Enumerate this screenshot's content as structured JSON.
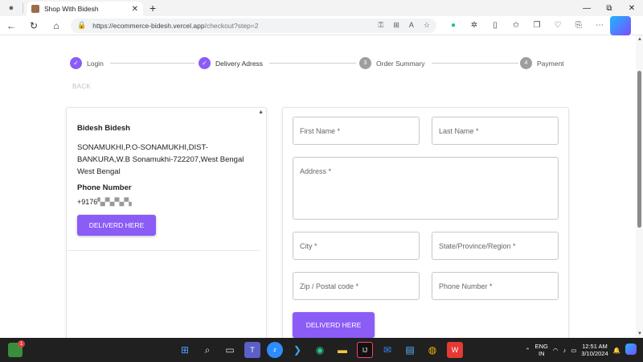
{
  "browser": {
    "tab_title": "Shop With Bidesh",
    "tab_close": "✕",
    "new_tab": "+",
    "url_domain": "https://ecommerce-bidesh.vercel.app",
    "url_path": "/checkout?step=2",
    "minimize": "—",
    "maximize": "⧉",
    "close": "✕"
  },
  "stepper": {
    "steps": [
      {
        "label": "Login",
        "status": "done",
        "number": "✓"
      },
      {
        "label": "Delivery Adress",
        "status": "done",
        "number": "✓"
      },
      {
        "label": "Order Summary",
        "status": "todo",
        "number": "3"
      },
      {
        "label": "Payment",
        "status": "todo",
        "number": "4"
      }
    ],
    "back_label": "BACK"
  },
  "saved_address": {
    "name": "Bidesh Bidesh",
    "address": "SONAMUKHI,P.O-SONAMUKHI,DIST-BANKURA,W.B Sonamukhi-722207,West Bengal West Bengal",
    "phone_label": "Phone Number",
    "phone_value": "+9176",
    "deliver_button": "DELIVERD HERE"
  },
  "form": {
    "first_name": "First Name *",
    "last_name": "Last Name *",
    "address": "Address *",
    "city": "City *",
    "state": "State/Province/Region *",
    "zip": "Zip / Postal code *",
    "phone": "Phone Number *",
    "submit": "DELIVERD HERE"
  },
  "taskbar": {
    "notif_count": "1",
    "lang_top": "ENG",
    "lang_bottom": "IN",
    "time": "12:51 AM",
    "date": "3/10/2024"
  },
  "colors": {
    "accent": "#8b5cf6",
    "step_todo": "#9e9e9e"
  }
}
